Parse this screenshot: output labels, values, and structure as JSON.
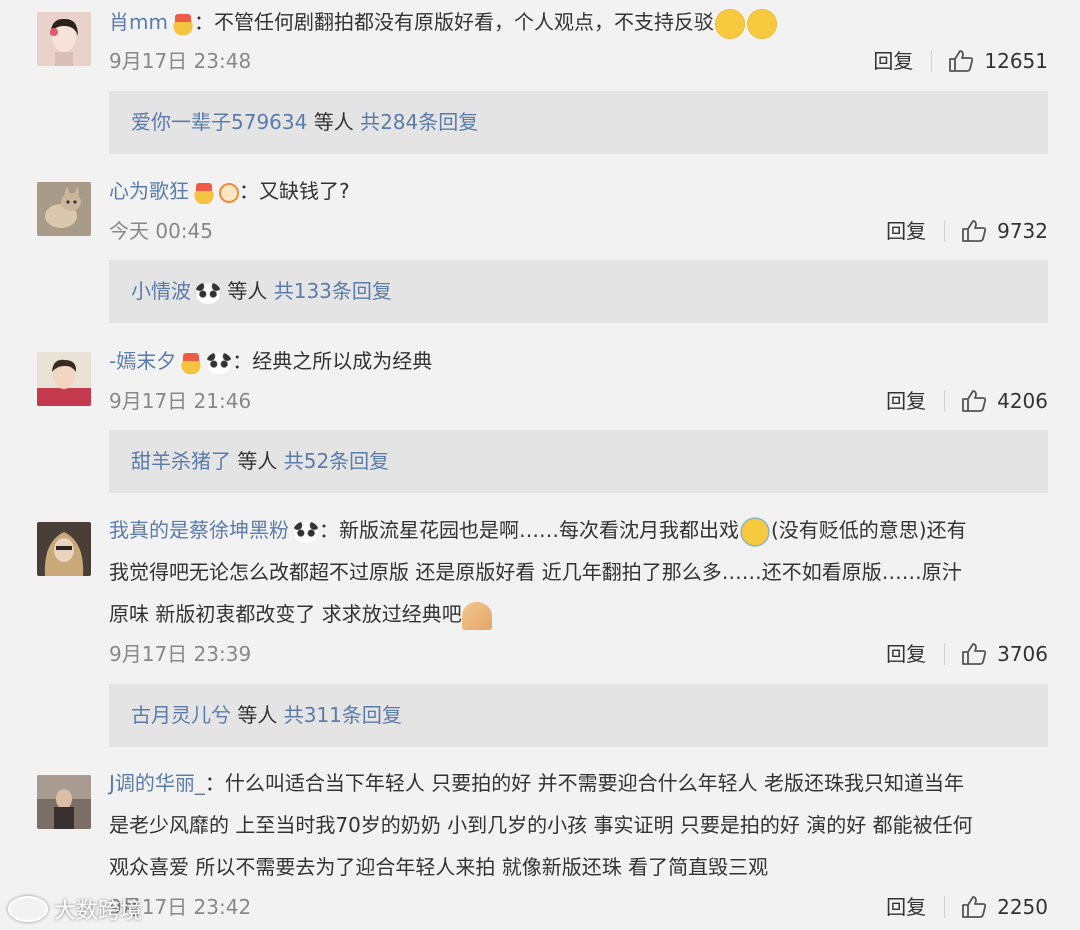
{
  "comments": [
    {
      "username": "肖mm",
      "text": "不管任何剧翻拍都没有原版好看，个人观点，不支持反驳",
      "time": "9月17日 23:48",
      "reply_label": "回复",
      "likes": "12651",
      "reply_user": "爱你一辈子579634",
      "reply_suffix": "等人",
      "reply_count": "共284条回复",
      "colors": {
        "avatar_bg": "#f0d8d4"
      }
    },
    {
      "username": "心为歌狂",
      "text": "又缺钱了?",
      "time": "今天 00:45",
      "reply_label": "回复",
      "likes": "9732",
      "reply_user": "小情波",
      "reply_suffix": "等人",
      "reply_count": "共133条回复",
      "colors": {
        "avatar_bg": "#b8a58e"
      }
    },
    {
      "username": "-嫣末夕",
      "text": "经典之所以成为经典",
      "time": "9月17日 21:46",
      "reply_label": "回复",
      "likes": "4206",
      "reply_user": "甜羊杀猪了",
      "reply_suffix": "等人",
      "reply_count": "共52条回复",
      "colors": {
        "avatar_bg": "#c43a4f"
      }
    },
    {
      "username": "我真的是蔡徐坤黑粉",
      "text_line1_a": "新版流星花园也是啊……每次看沈月我都出戏",
      "text_line1_b": "(没有贬低的意思)还有",
      "text_line2": "我觉得吧无论怎么改都超不过原版 还是原版好看 近几年翻拍了那么多……还不如看原版……原汁",
      "text_line3": "原味 新版初衷都改变了 求求放过经典吧",
      "time": "9月17日 23:39",
      "reply_label": "回复",
      "likes": "3706",
      "reply_user": "古月灵儿兮",
      "reply_suffix": "等人",
      "reply_count": "共311条回复",
      "colors": {
        "avatar_bg": "#6b5a4e"
      }
    },
    {
      "username": "J调的华丽_",
      "text_line1": "什么叫适合当下年轻人 只要拍的好 并不需要迎合什么年轻人 老版还珠我只知道当年",
      "text_line2": "是老少风靡的 上至当时我70岁的奶奶 小到几岁的小孩 事实证明 只要是拍的好 演的好 都能被任何",
      "text_line3": "观众喜爱 所以不需要去为了迎合年轻人来拍 就像新版还珠 看了简直毁三观",
      "time": "9月17日 23:42",
      "reply_label": "回复",
      "likes": "2250",
      "colors": {
        "avatar_bg": "#5e5550"
      }
    }
  ],
  "colon": "：",
  "watermark": {
    "text": "大数跨境",
    "icon": "weibo-icon"
  },
  "colors": {
    "link": "#5b7cab",
    "background": "#f2f2f2",
    "reply_box": "#e4e4e4"
  }
}
